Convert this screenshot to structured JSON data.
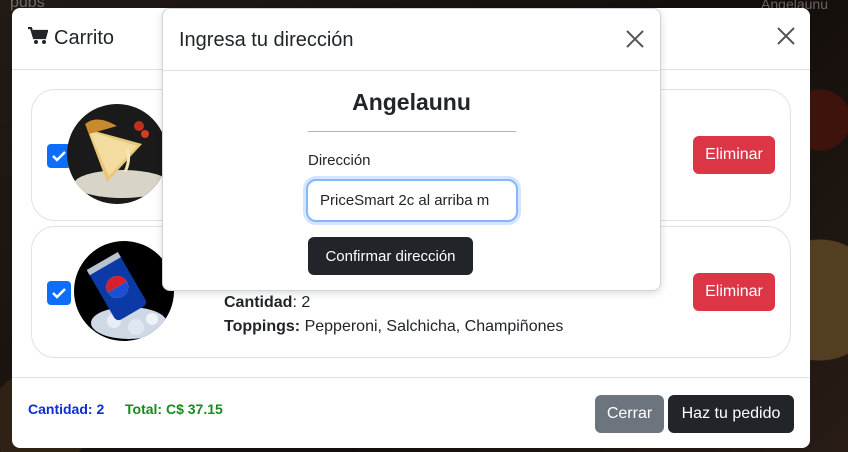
{
  "background": {
    "top_left_text": "pubs",
    "user_name": "Angelaunu"
  },
  "cart": {
    "title": "Carrito",
    "items": [
      {
        "image": "pizza-slice-photo",
        "checked": true,
        "delete_label": "Eliminar"
      },
      {
        "image": "pepsi-can-photo",
        "checked": true,
        "quantity_label": "Cantidad",
        "quantity_value": ": 2",
        "toppings_label": "Toppings:",
        "toppings_value": " Pepperoni, Salchicha, Champiñones",
        "delete_label": "Eliminar"
      }
    ],
    "footer": {
      "quantity_text": "Cantidad: 2",
      "total_text": "Total: C$ 37.15",
      "close_label": "Cerrar",
      "order_label": "Haz tu pedido"
    }
  },
  "address_modal": {
    "title": "Ingresa tu dirección",
    "user_name": "Angelaunu",
    "field_label": "Dirección",
    "field_value": "PriceSmart 2c al arriba m",
    "confirm_label": "Confirmar dirección"
  },
  "colors": {
    "primary": "#0d6efd",
    "danger": "#dc3545",
    "dark": "#212529",
    "secondary": "#6c757d",
    "quantity_blue": "#0d2bd6",
    "total_green": "#178a1b"
  }
}
